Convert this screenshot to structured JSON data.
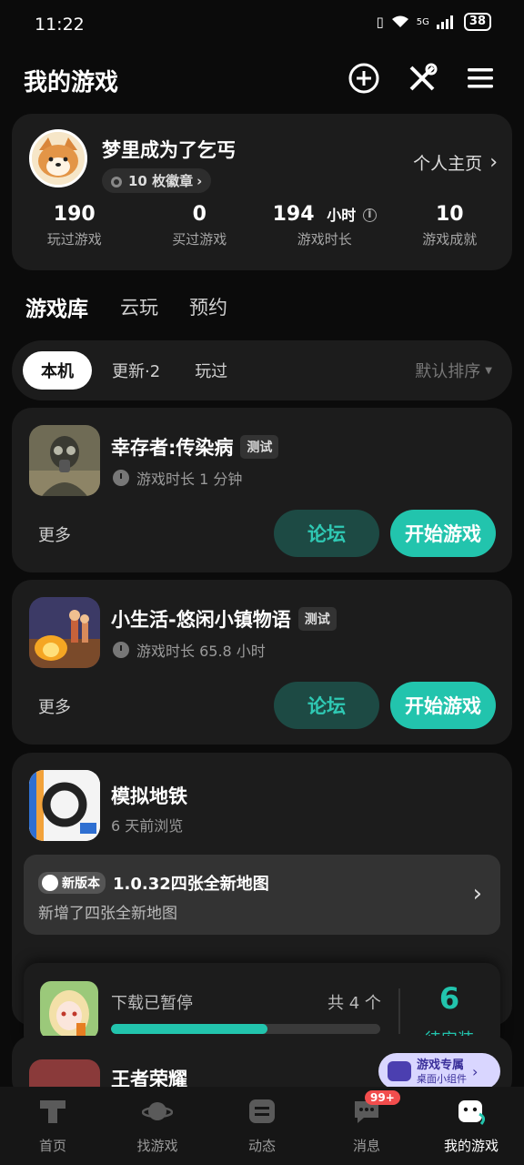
{
  "status_bar": {
    "time": "11:22",
    "signal": "5G",
    "battery": "38"
  },
  "header": {
    "title": "我的游戏"
  },
  "profile": {
    "name": "梦里成为了乞丐",
    "badges": "10 枚徽章",
    "homepage": "个人主页",
    "stats": [
      {
        "value": "190",
        "unit": "",
        "label": "玩过游戏"
      },
      {
        "value": "0",
        "unit": "",
        "label": "买过游戏"
      },
      {
        "value": "194",
        "unit": "小时",
        "label": "游戏时长"
      },
      {
        "value": "10",
        "unit": "",
        "label": "游戏成就"
      }
    ]
  },
  "main_tabs": [
    {
      "label": "游戏库",
      "active": true
    },
    {
      "label": "云玩",
      "active": false
    },
    {
      "label": "预约",
      "active": false
    }
  ],
  "filter": {
    "items": [
      {
        "label": "本机",
        "active": true
      },
      {
        "label": "更新·2",
        "active": false
      },
      {
        "label": "玩过",
        "active": false
      }
    ],
    "sort": "默认排序"
  },
  "games": [
    {
      "name": "幸存者:传染病",
      "tag": "测试",
      "playtime": "游戏时长 1 分钟",
      "more": "更多",
      "forum": "论坛",
      "start": "开始游戏"
    },
    {
      "name": "小生活-悠闲小镇物语",
      "tag": "测试",
      "playtime": "游戏时长 65.8 小时",
      "more": "更多",
      "forum": "论坛",
      "start": "开始游戏"
    }
  ],
  "subway": {
    "name": "模拟地铁",
    "viewed": "6 天前浏览",
    "update_badge": "新版本",
    "update_title": "1.0.32四张全新地图",
    "update_desc": "新增了四张全新地图"
  },
  "download": {
    "status": "下载已暂停",
    "total": "共 4 个",
    "progress": 0.58,
    "pending_count": "6",
    "pending_label": "待安装"
  },
  "next_game": {
    "name": "王者荣耀"
  },
  "widget": {
    "title": "游戏专属",
    "subtitle": "桌面小组件"
  },
  "nav": [
    {
      "label": "首页",
      "active": false
    },
    {
      "label": "找游戏",
      "active": false
    },
    {
      "label": "动态",
      "active": false
    },
    {
      "label": "消息",
      "active": false,
      "badge": "99+"
    },
    {
      "label": "我的游戏",
      "active": true
    }
  ],
  "colors": {
    "accent": "#22c4ad",
    "background": "#0b0b0b",
    "card": "#1c1c1c"
  }
}
